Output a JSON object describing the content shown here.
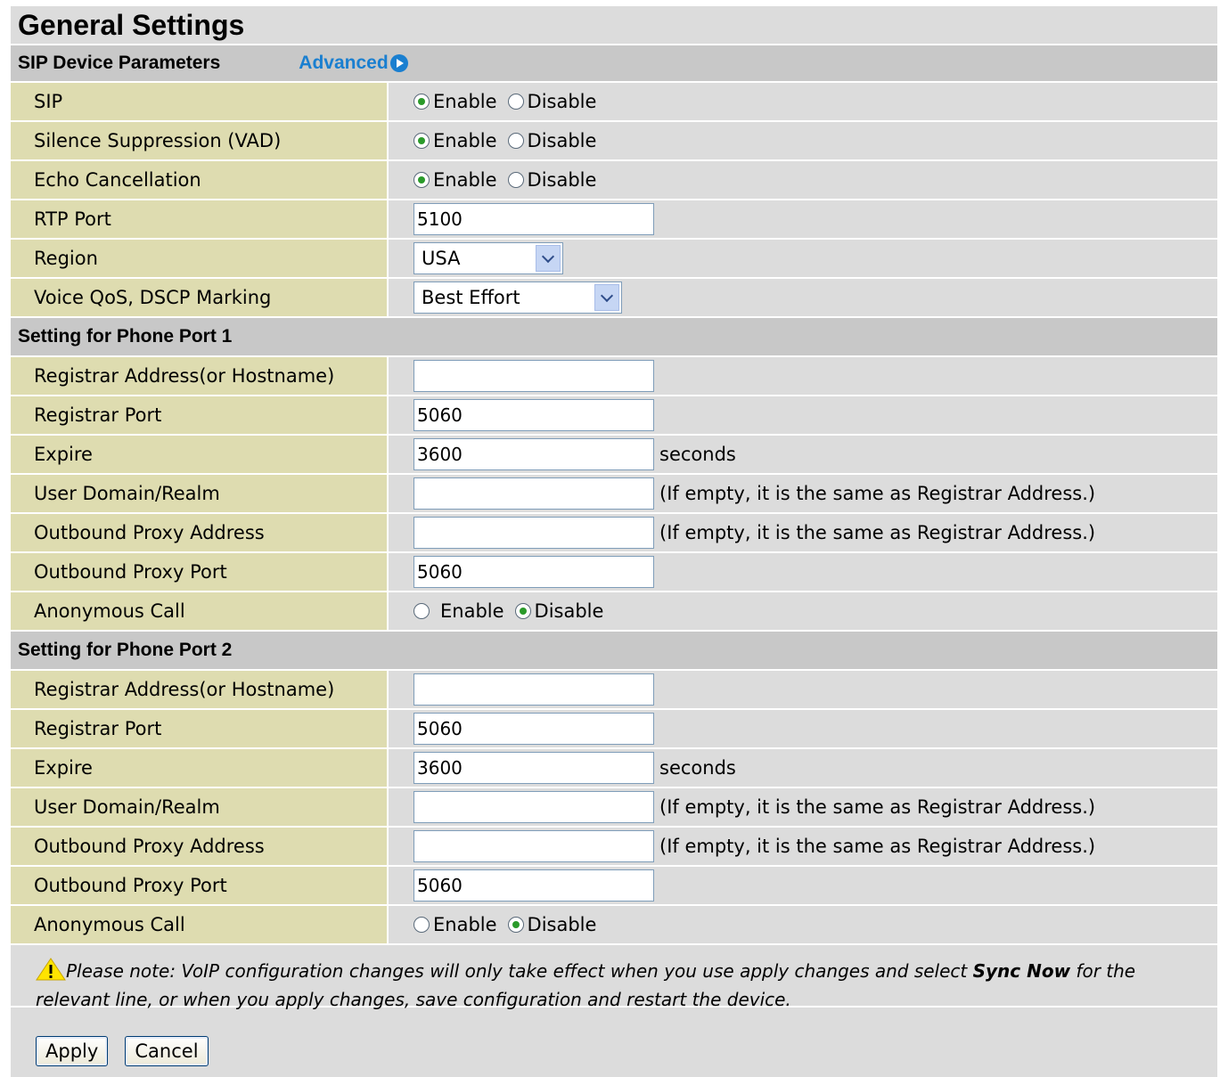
{
  "page_title": "General Settings",
  "sip_section": {
    "title": "SIP Device Parameters",
    "advanced_label": "Advanced",
    "rows": [
      {
        "label": "SIP",
        "type": "radio",
        "enable_label": "Enable",
        "disable_label": "Disable",
        "selected": "enable"
      },
      {
        "label": "Silence Suppression (VAD)",
        "type": "radio",
        "enable_label": "Enable",
        "disable_label": "Disable",
        "selected": "enable"
      },
      {
        "label": "Echo Cancellation",
        "type": "radio",
        "enable_label": "Enable",
        "disable_label": "Disable",
        "selected": "enable"
      },
      {
        "label": "RTP Port",
        "type": "input",
        "value": "5100"
      },
      {
        "label": "Region",
        "type": "select",
        "value": "USA"
      },
      {
        "label": "Voice QoS, DSCP Marking",
        "type": "select",
        "value": "Best Effort"
      }
    ]
  },
  "port1": {
    "title": "Setting for Phone Port 1",
    "registrar_address_label": "Registrar Address(or Hostname)",
    "registrar_address_value": "",
    "registrar_port_label": "Registrar Port",
    "registrar_port_value": "5060",
    "expire_label": "Expire",
    "expire_value": "3600",
    "expire_unit": "seconds",
    "user_domain_label": "User Domain/Realm",
    "user_domain_value": "",
    "user_domain_hint": "(If empty, it is the same as Registrar Address.)",
    "outbound_proxy_address_label": "Outbound Proxy Address",
    "outbound_proxy_address_value": "",
    "outbound_proxy_address_hint": "(If empty, it is the same as Registrar Address.)",
    "outbound_proxy_port_label": "Outbound Proxy Port",
    "outbound_proxy_port_value": "5060",
    "anonymous_call_label": "Anonymous Call",
    "anonymous_enable_label": "Enable",
    "anonymous_disable_label": "Disable",
    "anonymous_selected": "disable"
  },
  "port2": {
    "title": "Setting for Phone Port 2",
    "registrar_address_label": "Registrar Address(or Hostname)",
    "registrar_address_value": "",
    "registrar_port_label": "Registrar Port",
    "registrar_port_value": "5060",
    "expire_label": "Expire",
    "expire_value": "3600",
    "expire_unit": "seconds",
    "user_domain_label": "User Domain/Realm",
    "user_domain_value": "",
    "user_domain_hint": "(If empty, it is the same as Registrar Address.)",
    "outbound_proxy_address_label": "Outbound Proxy Address",
    "outbound_proxy_address_value": "",
    "outbound_proxy_address_hint": "(If empty, it is the same as Registrar Address.)",
    "outbound_proxy_port_label": "Outbound Proxy Port",
    "outbound_proxy_port_value": "5060",
    "anonymous_call_label": "Anonymous Call",
    "anonymous_enable_label": "Enable",
    "anonymous_disable_label": "Disable",
    "anonymous_selected": "disable"
  },
  "note": {
    "text_before": "Please note: VoIP configuration changes will only take effect when you use apply changes and select ",
    "bold": "Sync Now",
    "text_after": " for the relevant line, or when you apply changes, save configuration and restart the device.",
    "icon": "warning-icon"
  },
  "buttons": {
    "apply_label": "Apply",
    "cancel_label": "Cancel"
  },
  "colors": {
    "label_bg": "#dedcb0",
    "value_bg": "#dcdcdc",
    "section_bg": "#c8c8c8",
    "link": "#1a7fd0"
  }
}
